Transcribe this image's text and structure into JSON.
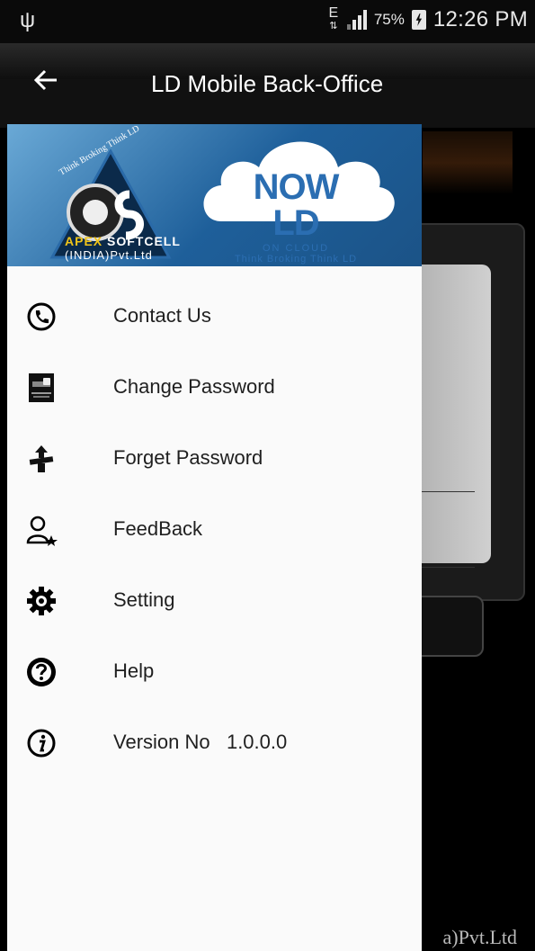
{
  "status_bar": {
    "network_label": "E",
    "battery_percent": "75%",
    "time": "12:26 PM"
  },
  "app_bar": {
    "title": "LD Mobile Back-Office"
  },
  "banner": {
    "brand_line1": "APEX SOFTCELL",
    "brand_apex": "APEX",
    "brand_softcell": "SOFTCELL",
    "brand_line2": "(INDIA)Pvt.Ltd",
    "arc_text": "Think Broking Think LD",
    "cloud_title": "NOW LD",
    "cloud_sub": "ON CLOUD",
    "cloud_tagline": "Think Broking Think LD"
  },
  "menu": {
    "items": [
      {
        "label": "Contact Us",
        "icon": "phone-icon"
      },
      {
        "label": "Change Password",
        "icon": "password-change-icon"
      },
      {
        "label": "Forget Password",
        "icon": "forget-password-icon"
      },
      {
        "label": "FeedBack",
        "icon": "feedback-user-icon"
      },
      {
        "label": "Setting",
        "icon": "gear-icon"
      },
      {
        "label": "Help",
        "icon": "help-icon"
      },
      {
        "label": "Version No   1.0.0.0",
        "icon": "info-icon"
      }
    ]
  },
  "background": {
    "footer_text": "a)Pvt.Ltd"
  }
}
